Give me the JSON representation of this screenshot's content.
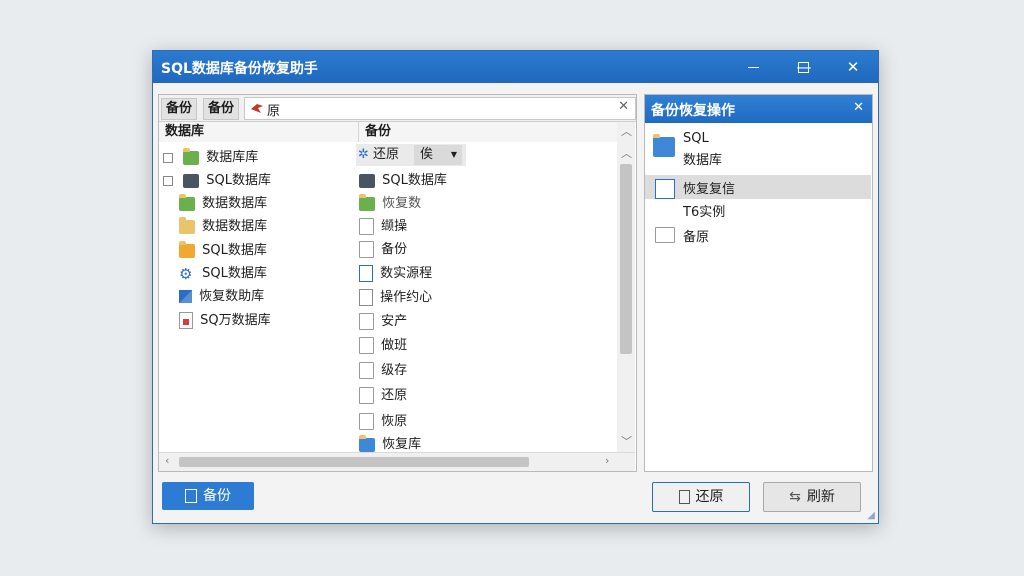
{
  "window": {
    "title": "SQL数据库备份恢复助手",
    "minimize_glyph": "—",
    "maximize_glyph": "☐",
    "close_glyph": "✕"
  },
  "left_panel": {
    "tabs": [
      "备份",
      "备份"
    ],
    "address_text": "原",
    "column_headers": [
      "数据库",
      "备份"
    ],
    "tree": [
      {
        "label": "数据库库",
        "icon": "database-folder-icon",
        "expander": true
      },
      {
        "label": "SQL数据库",
        "icon": "server-icon",
        "expander": true
      },
      {
        "label": "数据数据库",
        "icon": "database-folder-icon"
      },
      {
        "label": "数据数据库",
        "icon": "database-folder-icon"
      },
      {
        "label": "SQL数据库",
        "icon": "database-folder-icon"
      },
      {
        "label": "SQL数据库",
        "icon": "gear-icon"
      },
      {
        "label": "恢复数助库",
        "icon": "restore-icon"
      },
      {
        "label": "SQ万数据库",
        "icon": "report-icon"
      }
    ],
    "toolbar": {
      "restore_label": "还原",
      "dropdown_label": "俟"
    },
    "files": [
      {
        "label": "SQL数据库",
        "icon": "server-icon"
      },
      {
        "label": "恢复数",
        "icon": "database-folder-icon"
      },
      {
        "label": "缬操",
        "icon": "blank-file-icon"
      },
      {
        "label": "备份",
        "icon": "blank-file-icon"
      },
      {
        "label": "数实源程",
        "icon": "document-icon"
      },
      {
        "label": "操作约心",
        "icon": "checklist-icon"
      },
      {
        "label": "安产",
        "icon": "blank-file-icon"
      },
      {
        "label": "做班",
        "icon": "blank-file-icon"
      },
      {
        "label": "级存",
        "icon": "blank-file-icon"
      },
      {
        "label": "还原",
        "icon": "blank-file-icon"
      },
      {
        "label": "恢原",
        "icon": "blank-file-icon"
      },
      {
        "label": "恢复库",
        "icon": "folder-icon"
      }
    ]
  },
  "right_panel": {
    "title": "备份恢复操作",
    "items": [
      {
        "line1": "SQL",
        "line2": "数据库",
        "icon": "database-folder-icon"
      },
      {
        "line1": "恢复复信",
        "line2": "T6实例",
        "icon": "restore-icon",
        "selected": true
      },
      {
        "line1": "备原",
        "line2": "",
        "icon": "folder-icon"
      }
    ]
  },
  "buttons": {
    "backup": "备份",
    "restore": "还原",
    "refresh": "刷新"
  },
  "colors": {
    "accent": "#1f6bc1",
    "title_bar": "#2576cc",
    "selected_row": "#dcdcdc",
    "backup_button": "#2d7bd3"
  }
}
